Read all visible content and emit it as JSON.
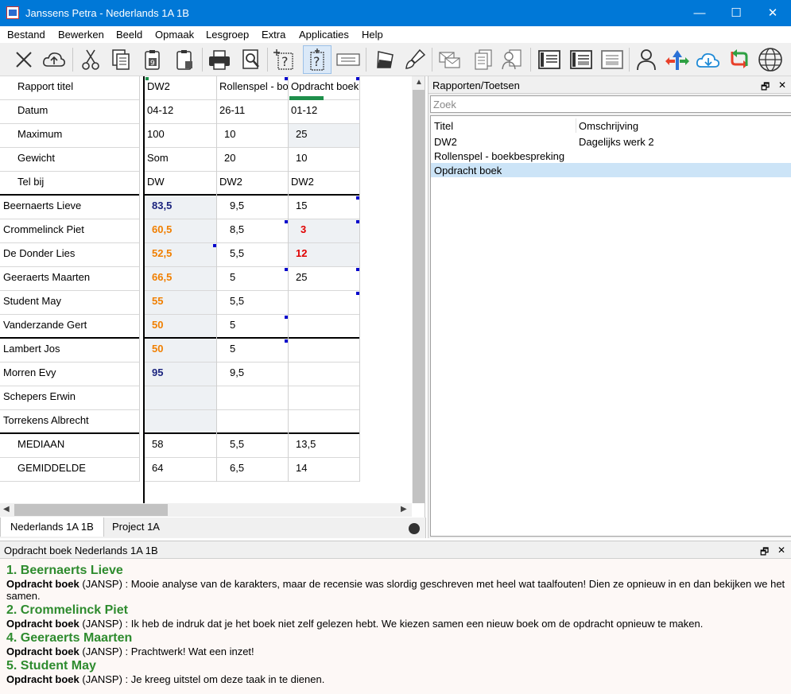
{
  "window": {
    "title": "Janssens Petra - Nederlands 1A 1B",
    "controls": {
      "minimize": "—",
      "maximize": "☐",
      "close": "✕"
    }
  },
  "menu": [
    "Bestand",
    "Bewerken",
    "Beeld",
    "Opmaak",
    "Lesgroep",
    "Extra",
    "Applicaties",
    "Help"
  ],
  "grid": {
    "header_rows": [
      {
        "label": "Rapport titel",
        "values": [
          "DW2",
          "Rollenspel - boekbespreking",
          "Opdracht boek"
        ]
      },
      {
        "label": "Datum",
        "values": [
          "04-12",
          "26-11",
          "01-12"
        ]
      },
      {
        "label": "Maximum",
        "values": [
          "100",
          "10",
          "25"
        ]
      },
      {
        "label": "Gewicht",
        "values": [
          "Som",
          "20",
          "10"
        ]
      },
      {
        "label": "Tel bij",
        "values": [
          "DW",
          "DW2",
          "DW2"
        ]
      }
    ],
    "students": [
      {
        "name": "Beernaerts Lieve",
        "scores": [
          "83,5",
          "9,5",
          "15"
        ]
      },
      {
        "name": "Crommelinck Piet",
        "scores": [
          "60,5",
          "8,5",
          "3"
        ]
      },
      {
        "name": "De Donder Lies",
        "scores": [
          "52,5",
          "5,5",
          "12"
        ]
      },
      {
        "name": "Geeraerts Maarten",
        "scores": [
          "66,5",
          "5",
          "25"
        ]
      },
      {
        "name": "Student May",
        "scores": [
          "55",
          "5,5",
          ""
        ]
      },
      {
        "name": "Vanderzande Gert",
        "scores": [
          "50",
          "5",
          ""
        ]
      },
      {
        "name": "Lambert Jos",
        "scores": [
          "50",
          "5",
          ""
        ]
      },
      {
        "name": "Morren Evy",
        "scores": [
          "95",
          "9,5",
          ""
        ]
      },
      {
        "name": "Schepers Erwin",
        "scores": [
          "",
          "",
          ""
        ]
      },
      {
        "name": "Torrekens Albrecht",
        "scores": [
          "",
          "",
          ""
        ]
      }
    ],
    "stat_rows": [
      {
        "label": "MEDIAAN",
        "values": [
          "58",
          "5,5",
          "13,5"
        ]
      },
      {
        "label": "GEMIDDELDE",
        "values": [
          "64",
          "6,5",
          "14"
        ]
      }
    ],
    "colors": {
      "good": "#1a237e",
      "warn": "#f07f00",
      "fail": "#e00000",
      "shade": "#eef1f4"
    }
  },
  "sheet_tabs": [
    "Nederlands 1A 1B",
    "Project 1A"
  ],
  "reports_panel": {
    "title": "Rapporten/Toetsen",
    "search_placeholder": "Zoek",
    "columns": [
      "Titel",
      "Omschrijving"
    ],
    "rows": [
      {
        "title": "DW2",
        "description": "Dagelijks werk 2"
      },
      {
        "title": "Rollenspel - boekbespreking",
        "description": ""
      },
      {
        "title": "Opdracht boek",
        "description": ""
      }
    ],
    "selected_index": 2
  },
  "comments_panel": {
    "title": "Opdracht boek Nederlands 1A 1B",
    "entries": [
      {
        "heading": "1. Beernaerts Lieve",
        "source": "Opdracht boek",
        "author": "(JANSP) :",
        "text": "Mooie analyse van de karakters, maar de recensie was slordig geschreven met heel wat taalfouten! Dien ze opnieuw in en dan bekijken we het samen."
      },
      {
        "heading": "2. Crommelinck Piet",
        "source": "Opdracht boek",
        "author": "(JANSP) :",
        "text": "Ik heb de indruk dat je het boek niet zelf gelezen hebt. We kiezen samen een nieuw boek om de opdracht opnieuw te maken."
      },
      {
        "heading": "4. Geeraerts Maarten",
        "source": "Opdracht boek",
        "author": "(JANSP) :",
        "text": "Prachtwerk! Wat een inzet!"
      },
      {
        "heading": "5. Student May",
        "source": "Opdracht boek",
        "author": "(JANSP) :",
        "text": "Je kreeg uitstel om deze taak in te dienen."
      }
    ]
  },
  "toolbar_icons": [
    "cut-x-icon",
    "upload-cloud-icon",
    "scissors-icon",
    "copy-icon",
    "paste-icon",
    "paste-special-icon",
    "print-icon",
    "print-preview-icon",
    "question-field-icon",
    "question-field-active-icon",
    "field-icon",
    "fill-icon",
    "brush-icon",
    "mail-icon",
    "document-icon",
    "search-person-icon",
    "layout1-icon",
    "layout2-icon",
    "layout3-icon",
    "person-icon",
    "arrows-icon",
    "download-cloud-icon",
    "swap-icon",
    "globe-icon"
  ]
}
